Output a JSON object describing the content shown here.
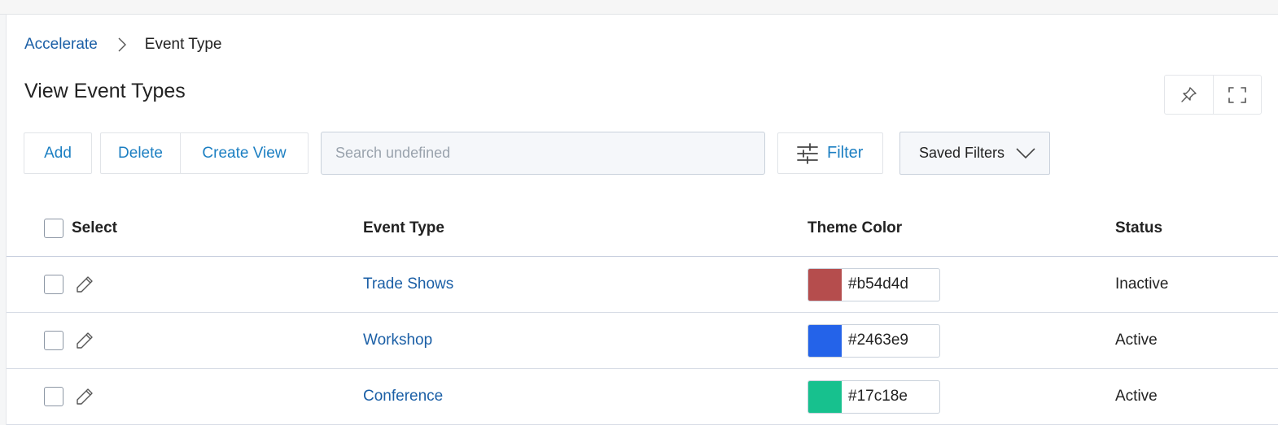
{
  "breadcrumb": {
    "root": "Accelerate",
    "current": "Event Type"
  },
  "page": {
    "title": "View Event Types"
  },
  "toolbar": {
    "add_label": "Add",
    "delete_label": "Delete",
    "create_view_label": "Create View",
    "search_placeholder": "Search undefined",
    "filter_label": "Filter",
    "saved_filters_label": "Saved Filters"
  },
  "table": {
    "headers": {
      "select": "Select",
      "event_type": "Event Type",
      "theme_color": "Theme Color",
      "status": "Status"
    },
    "rows": [
      {
        "event_type": "Trade Shows",
        "theme_color": "#b54d4d",
        "status": "Inactive"
      },
      {
        "event_type": "Workshop",
        "theme_color": "#2463e9",
        "status": "Active"
      },
      {
        "event_type": "Conference",
        "theme_color": "#17c18e",
        "status": "Active"
      }
    ]
  },
  "icons": {
    "pin": "pin-icon",
    "fullscreen": "fullscreen-icon",
    "filter": "sliders-icon",
    "chevron": "chevron-down-icon",
    "edit": "pencil-icon",
    "separator": "chevron-right-icon"
  },
  "colors": {
    "link": "#1b5fa6",
    "accent": "#1c7fc2",
    "border": "#e1e4e8"
  }
}
